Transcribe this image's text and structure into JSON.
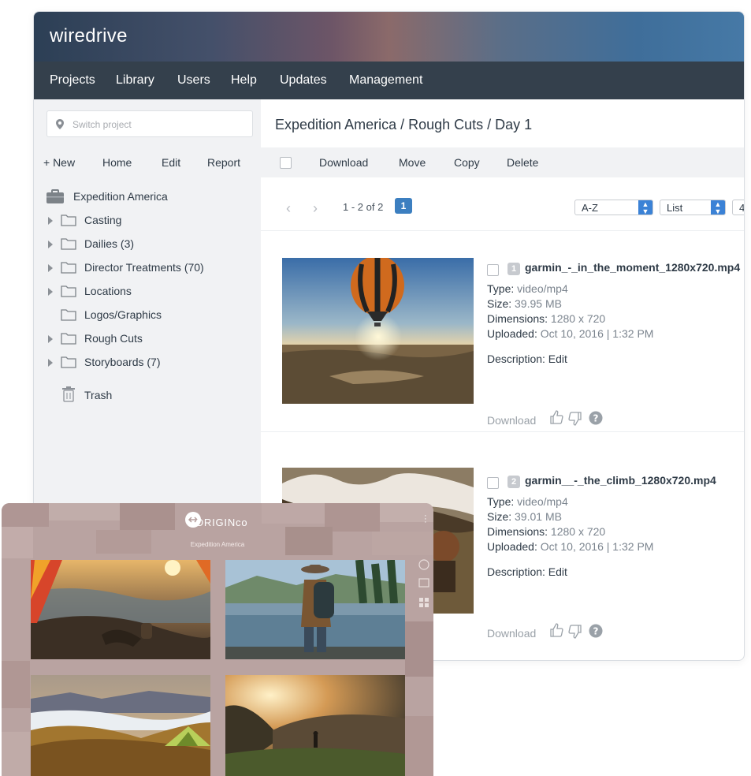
{
  "brand": "wiredrive",
  "nav": [
    "Projects",
    "Library",
    "Users",
    "Help",
    "Updates",
    "Management"
  ],
  "search": {
    "placeholder": "Switch project"
  },
  "side_actions": [
    "+ New",
    "Home",
    "Edit",
    "Report"
  ],
  "tree": {
    "root": "Expedition America",
    "folders": [
      {
        "label": "Casting",
        "expandable": true
      },
      {
        "label": "Dailies (3)",
        "expandable": true
      },
      {
        "label": "Director Treatments (70)",
        "expandable": true
      },
      {
        "label": "Locations",
        "expandable": true
      },
      {
        "label": "Logos/Graphics",
        "expandable": false
      },
      {
        "label": "Rough Cuts",
        "expandable": true
      },
      {
        "label": "Storyboards (7)",
        "expandable": true
      }
    ],
    "trash": "Trash"
  },
  "main": {
    "breadcrumb": "Expedition America / Rough Cuts / Day 1",
    "toolbar": [
      "Download",
      "Move",
      "Copy",
      "Delete"
    ],
    "pager": {
      "range": "1 - 2 of 2",
      "page": "1"
    },
    "sort": "A-Z",
    "view": "List",
    "per_page": "4"
  },
  "assets": [
    {
      "index": "1",
      "filename": "garmin_-_in_the_moment_1280x720.mp4",
      "type_label": "Type:",
      "type": "video/mp4",
      "size_label": "Size:",
      "size": "39.95 MB",
      "dims_label": "Dimensions:",
      "dims": "1280 x 720",
      "uploaded_label": "Uploaded:",
      "uploaded": "Oct 10, 2016 | 1:32 PM",
      "description": "Description: Edit",
      "download": "Download"
    },
    {
      "index": "2",
      "filename": "garmin__-_the_climb_1280x720.mp4",
      "type_label": "Type:",
      "type": "video/mp4",
      "size_label": "Size:",
      "size": "39.01 MB",
      "dims_label": "Dimensions:",
      "dims": "1280 x 720",
      "uploaded_label": "Uploaded:",
      "uploaded": "Oct 10, 2016 | 1:32 PM",
      "description": "Description: Edit",
      "download": "Download"
    }
  ],
  "overlay": {
    "logo_text": "ORIGINco",
    "subtitle": "Expedition America"
  },
  "colors": {
    "nav_bg": "#34404c",
    "sidebar_bg": "#f1f2f4",
    "accent": "#3c7fc0"
  }
}
